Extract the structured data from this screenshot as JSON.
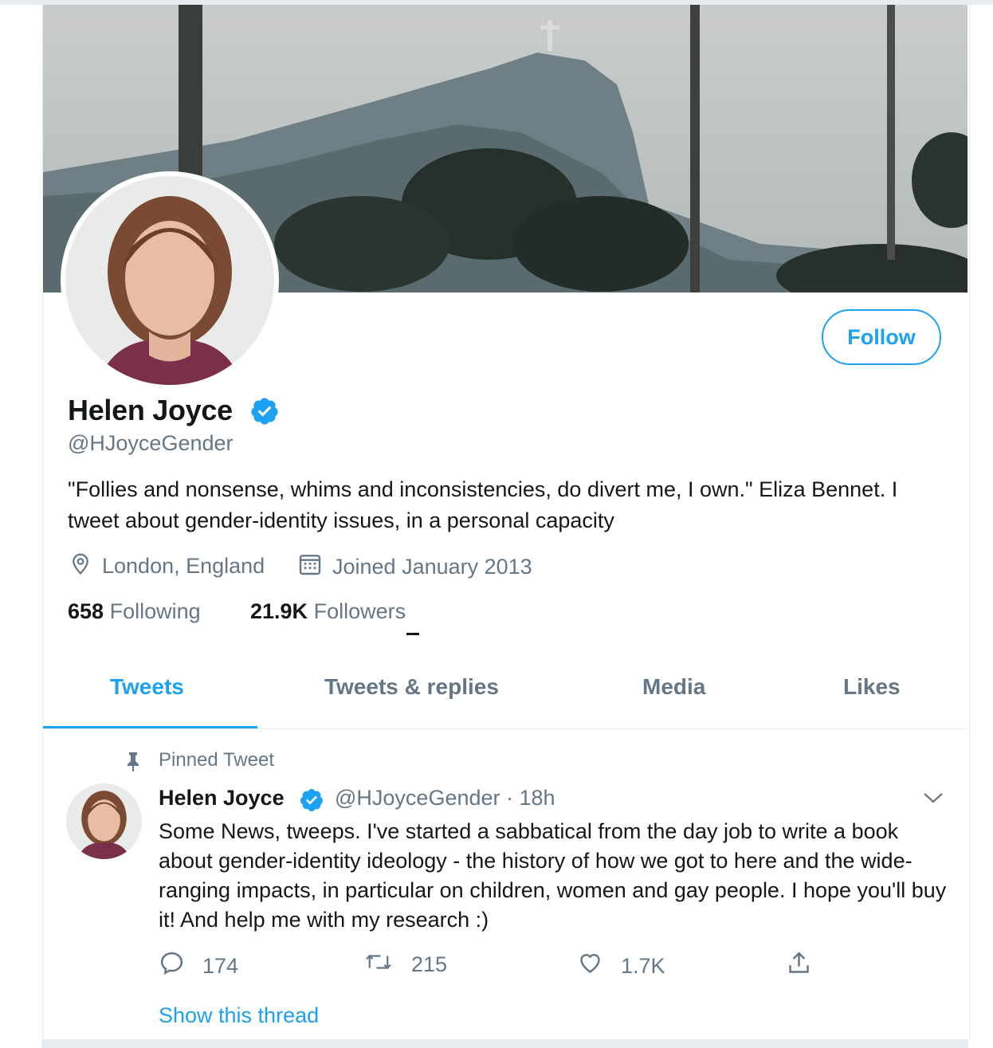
{
  "profile": {
    "name": "Helen Joyce",
    "handle": "@HJoyceGender",
    "bio": "\"Follies and nonsense, whims and inconsistencies, do divert me, I own.\" Eliza Bennet. I tweet about gender-identity issues, in a personal capacity",
    "location": "London, England",
    "joined": "Joined January 2013",
    "following_count": "658",
    "following_label": "Following",
    "followers_count": "21.9K",
    "followers_label": "Followers",
    "follow_button": "Follow"
  },
  "tabs": [
    {
      "label": "Tweets",
      "active": true
    },
    {
      "label": "Tweets & replies",
      "active": false
    },
    {
      "label": "Media",
      "active": false
    },
    {
      "label": "Likes",
      "active": false
    }
  ],
  "pinned_tweet": {
    "pinned_label": "Pinned Tweet",
    "author": "Helen Joyce",
    "meta": "@HJoyceGender · 18h",
    "text": "Some News, tweeps. I've started a sabbatical from the day job to write a book about gender-identity ideology - the history of how we got to here and the wide-ranging impacts, in particular on children, women and gay people. I hope you'll buy it! And help me with my research :)",
    "replies": "174",
    "retweets": "215",
    "likes": "1.7K",
    "show_thread": "Show this thread"
  },
  "colors": {
    "accent": "#1da1f2",
    "muted": "#657786",
    "text": "#14171a"
  },
  "icons": [
    "verified-badge-icon",
    "location-pin-icon",
    "calendar-icon",
    "pin-icon",
    "chevron-down-icon",
    "reply-icon",
    "retweet-icon",
    "like-heart-icon",
    "share-icon"
  ]
}
